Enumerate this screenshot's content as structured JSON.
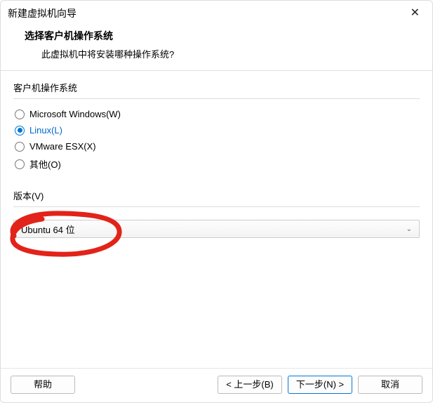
{
  "window": {
    "title": "新建虚拟机向导",
    "close": "✕"
  },
  "header": {
    "heading": "选择客户机操作系统",
    "subheading": "此虚拟机中将安装哪种操作系统?"
  },
  "os_group": {
    "label": "客户机操作系统",
    "options": [
      {
        "label": "Microsoft Windows(W)",
        "selected": false
      },
      {
        "label": "Linux(L)",
        "selected": true
      },
      {
        "label": "VMware ESX(X)",
        "selected": false
      },
      {
        "label": "其他(O)",
        "selected": false
      }
    ]
  },
  "version": {
    "label": "版本(V)",
    "selected": "Ubuntu 64 位"
  },
  "buttons": {
    "help": "帮助",
    "back": "< 上一步(B)",
    "next": "下一步(N) >",
    "cancel": "取消"
  }
}
